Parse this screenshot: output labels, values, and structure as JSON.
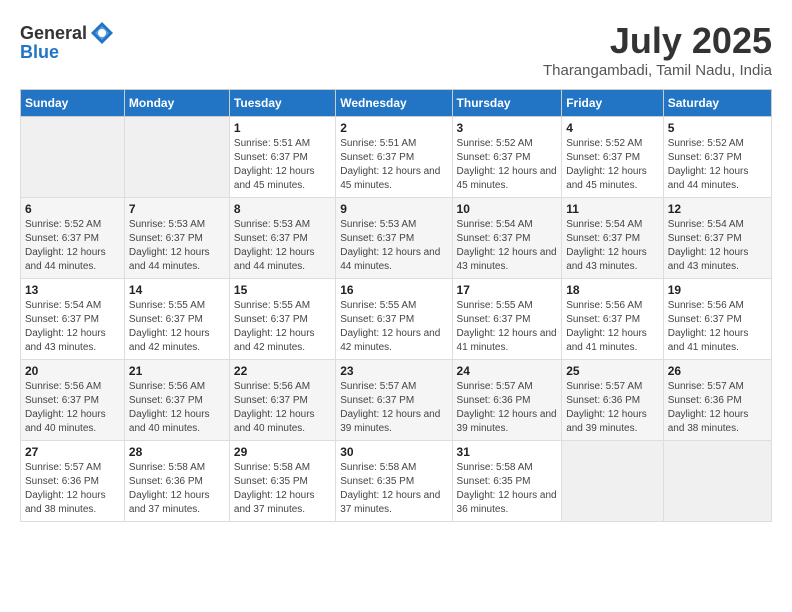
{
  "header": {
    "logo_general": "General",
    "logo_blue": "Blue",
    "month_year": "July 2025",
    "location": "Tharangambadi, Tamil Nadu, India"
  },
  "days_of_week": [
    "Sunday",
    "Monday",
    "Tuesday",
    "Wednesday",
    "Thursday",
    "Friday",
    "Saturday"
  ],
  "weeks": [
    [
      {
        "day": null
      },
      {
        "day": null
      },
      {
        "day": 1,
        "sunrise": "Sunrise: 5:51 AM",
        "sunset": "Sunset: 6:37 PM",
        "daylight": "Daylight: 12 hours and 45 minutes."
      },
      {
        "day": 2,
        "sunrise": "Sunrise: 5:51 AM",
        "sunset": "Sunset: 6:37 PM",
        "daylight": "Daylight: 12 hours and 45 minutes."
      },
      {
        "day": 3,
        "sunrise": "Sunrise: 5:52 AM",
        "sunset": "Sunset: 6:37 PM",
        "daylight": "Daylight: 12 hours and 45 minutes."
      },
      {
        "day": 4,
        "sunrise": "Sunrise: 5:52 AM",
        "sunset": "Sunset: 6:37 PM",
        "daylight": "Daylight: 12 hours and 45 minutes."
      },
      {
        "day": 5,
        "sunrise": "Sunrise: 5:52 AM",
        "sunset": "Sunset: 6:37 PM",
        "daylight": "Daylight: 12 hours and 44 minutes."
      }
    ],
    [
      {
        "day": 6,
        "sunrise": "Sunrise: 5:52 AM",
        "sunset": "Sunset: 6:37 PM",
        "daylight": "Daylight: 12 hours and 44 minutes."
      },
      {
        "day": 7,
        "sunrise": "Sunrise: 5:53 AM",
        "sunset": "Sunset: 6:37 PM",
        "daylight": "Daylight: 12 hours and 44 minutes."
      },
      {
        "day": 8,
        "sunrise": "Sunrise: 5:53 AM",
        "sunset": "Sunset: 6:37 PM",
        "daylight": "Daylight: 12 hours and 44 minutes."
      },
      {
        "day": 9,
        "sunrise": "Sunrise: 5:53 AM",
        "sunset": "Sunset: 6:37 PM",
        "daylight": "Daylight: 12 hours and 44 minutes."
      },
      {
        "day": 10,
        "sunrise": "Sunrise: 5:54 AM",
        "sunset": "Sunset: 6:37 PM",
        "daylight": "Daylight: 12 hours and 43 minutes."
      },
      {
        "day": 11,
        "sunrise": "Sunrise: 5:54 AM",
        "sunset": "Sunset: 6:37 PM",
        "daylight": "Daylight: 12 hours and 43 minutes."
      },
      {
        "day": 12,
        "sunrise": "Sunrise: 5:54 AM",
        "sunset": "Sunset: 6:37 PM",
        "daylight": "Daylight: 12 hours and 43 minutes."
      }
    ],
    [
      {
        "day": 13,
        "sunrise": "Sunrise: 5:54 AM",
        "sunset": "Sunset: 6:37 PM",
        "daylight": "Daylight: 12 hours and 43 minutes."
      },
      {
        "day": 14,
        "sunrise": "Sunrise: 5:55 AM",
        "sunset": "Sunset: 6:37 PM",
        "daylight": "Daylight: 12 hours and 42 minutes."
      },
      {
        "day": 15,
        "sunrise": "Sunrise: 5:55 AM",
        "sunset": "Sunset: 6:37 PM",
        "daylight": "Daylight: 12 hours and 42 minutes."
      },
      {
        "day": 16,
        "sunrise": "Sunrise: 5:55 AM",
        "sunset": "Sunset: 6:37 PM",
        "daylight": "Daylight: 12 hours and 42 minutes."
      },
      {
        "day": 17,
        "sunrise": "Sunrise: 5:55 AM",
        "sunset": "Sunset: 6:37 PM",
        "daylight": "Daylight: 12 hours and 41 minutes."
      },
      {
        "day": 18,
        "sunrise": "Sunrise: 5:56 AM",
        "sunset": "Sunset: 6:37 PM",
        "daylight": "Daylight: 12 hours and 41 minutes."
      },
      {
        "day": 19,
        "sunrise": "Sunrise: 5:56 AM",
        "sunset": "Sunset: 6:37 PM",
        "daylight": "Daylight: 12 hours and 41 minutes."
      }
    ],
    [
      {
        "day": 20,
        "sunrise": "Sunrise: 5:56 AM",
        "sunset": "Sunset: 6:37 PM",
        "daylight": "Daylight: 12 hours and 40 minutes."
      },
      {
        "day": 21,
        "sunrise": "Sunrise: 5:56 AM",
        "sunset": "Sunset: 6:37 PM",
        "daylight": "Daylight: 12 hours and 40 minutes."
      },
      {
        "day": 22,
        "sunrise": "Sunrise: 5:56 AM",
        "sunset": "Sunset: 6:37 PM",
        "daylight": "Daylight: 12 hours and 40 minutes."
      },
      {
        "day": 23,
        "sunrise": "Sunrise: 5:57 AM",
        "sunset": "Sunset: 6:37 PM",
        "daylight": "Daylight: 12 hours and 39 minutes."
      },
      {
        "day": 24,
        "sunrise": "Sunrise: 5:57 AM",
        "sunset": "Sunset: 6:36 PM",
        "daylight": "Daylight: 12 hours and 39 minutes."
      },
      {
        "day": 25,
        "sunrise": "Sunrise: 5:57 AM",
        "sunset": "Sunset: 6:36 PM",
        "daylight": "Daylight: 12 hours and 39 minutes."
      },
      {
        "day": 26,
        "sunrise": "Sunrise: 5:57 AM",
        "sunset": "Sunset: 6:36 PM",
        "daylight": "Daylight: 12 hours and 38 minutes."
      }
    ],
    [
      {
        "day": 27,
        "sunrise": "Sunrise: 5:57 AM",
        "sunset": "Sunset: 6:36 PM",
        "daylight": "Daylight: 12 hours and 38 minutes."
      },
      {
        "day": 28,
        "sunrise": "Sunrise: 5:58 AM",
        "sunset": "Sunset: 6:36 PM",
        "daylight": "Daylight: 12 hours and 37 minutes."
      },
      {
        "day": 29,
        "sunrise": "Sunrise: 5:58 AM",
        "sunset": "Sunset: 6:35 PM",
        "daylight": "Daylight: 12 hours and 37 minutes."
      },
      {
        "day": 30,
        "sunrise": "Sunrise: 5:58 AM",
        "sunset": "Sunset: 6:35 PM",
        "daylight": "Daylight: 12 hours and 37 minutes."
      },
      {
        "day": 31,
        "sunrise": "Sunrise: 5:58 AM",
        "sunset": "Sunset: 6:35 PM",
        "daylight": "Daylight: 12 hours and 36 minutes."
      },
      {
        "day": null
      },
      {
        "day": null
      }
    ]
  ]
}
